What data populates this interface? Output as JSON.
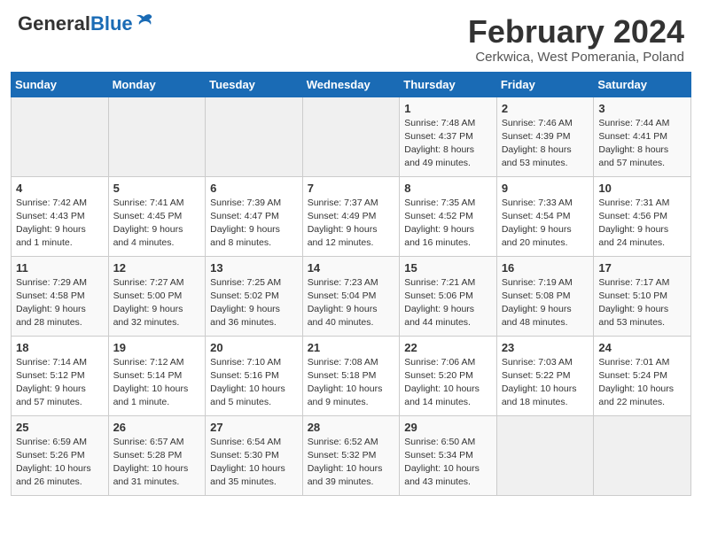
{
  "header": {
    "logo_general": "General",
    "logo_blue": "Blue",
    "month_title": "February 2024",
    "subtitle": "Cerkwica, West Pomerania, Poland"
  },
  "days_of_week": [
    "Sunday",
    "Monday",
    "Tuesday",
    "Wednesday",
    "Thursday",
    "Friday",
    "Saturday"
  ],
  "weeks": [
    [
      {
        "day": "",
        "info": ""
      },
      {
        "day": "",
        "info": ""
      },
      {
        "day": "",
        "info": ""
      },
      {
        "day": "",
        "info": ""
      },
      {
        "day": "1",
        "info": "Sunrise: 7:48 AM\nSunset: 4:37 PM\nDaylight: 8 hours\nand 49 minutes."
      },
      {
        "day": "2",
        "info": "Sunrise: 7:46 AM\nSunset: 4:39 PM\nDaylight: 8 hours\nand 53 minutes."
      },
      {
        "day": "3",
        "info": "Sunrise: 7:44 AM\nSunset: 4:41 PM\nDaylight: 8 hours\nand 57 minutes."
      }
    ],
    [
      {
        "day": "4",
        "info": "Sunrise: 7:42 AM\nSunset: 4:43 PM\nDaylight: 9 hours\nand 1 minute."
      },
      {
        "day": "5",
        "info": "Sunrise: 7:41 AM\nSunset: 4:45 PM\nDaylight: 9 hours\nand 4 minutes."
      },
      {
        "day": "6",
        "info": "Sunrise: 7:39 AM\nSunset: 4:47 PM\nDaylight: 9 hours\nand 8 minutes."
      },
      {
        "day": "7",
        "info": "Sunrise: 7:37 AM\nSunset: 4:49 PM\nDaylight: 9 hours\nand 12 minutes."
      },
      {
        "day": "8",
        "info": "Sunrise: 7:35 AM\nSunset: 4:52 PM\nDaylight: 9 hours\nand 16 minutes."
      },
      {
        "day": "9",
        "info": "Sunrise: 7:33 AM\nSunset: 4:54 PM\nDaylight: 9 hours\nand 20 minutes."
      },
      {
        "day": "10",
        "info": "Sunrise: 7:31 AM\nSunset: 4:56 PM\nDaylight: 9 hours\nand 24 minutes."
      }
    ],
    [
      {
        "day": "11",
        "info": "Sunrise: 7:29 AM\nSunset: 4:58 PM\nDaylight: 9 hours\nand 28 minutes."
      },
      {
        "day": "12",
        "info": "Sunrise: 7:27 AM\nSunset: 5:00 PM\nDaylight: 9 hours\nand 32 minutes."
      },
      {
        "day": "13",
        "info": "Sunrise: 7:25 AM\nSunset: 5:02 PM\nDaylight: 9 hours\nand 36 minutes."
      },
      {
        "day": "14",
        "info": "Sunrise: 7:23 AM\nSunset: 5:04 PM\nDaylight: 9 hours\nand 40 minutes."
      },
      {
        "day": "15",
        "info": "Sunrise: 7:21 AM\nSunset: 5:06 PM\nDaylight: 9 hours\nand 44 minutes."
      },
      {
        "day": "16",
        "info": "Sunrise: 7:19 AM\nSunset: 5:08 PM\nDaylight: 9 hours\nand 48 minutes."
      },
      {
        "day": "17",
        "info": "Sunrise: 7:17 AM\nSunset: 5:10 PM\nDaylight: 9 hours\nand 53 minutes."
      }
    ],
    [
      {
        "day": "18",
        "info": "Sunrise: 7:14 AM\nSunset: 5:12 PM\nDaylight: 9 hours\nand 57 minutes."
      },
      {
        "day": "19",
        "info": "Sunrise: 7:12 AM\nSunset: 5:14 PM\nDaylight: 10 hours\nand 1 minute."
      },
      {
        "day": "20",
        "info": "Sunrise: 7:10 AM\nSunset: 5:16 PM\nDaylight: 10 hours\nand 5 minutes."
      },
      {
        "day": "21",
        "info": "Sunrise: 7:08 AM\nSunset: 5:18 PM\nDaylight: 10 hours\nand 9 minutes."
      },
      {
        "day": "22",
        "info": "Sunrise: 7:06 AM\nSunset: 5:20 PM\nDaylight: 10 hours\nand 14 minutes."
      },
      {
        "day": "23",
        "info": "Sunrise: 7:03 AM\nSunset: 5:22 PM\nDaylight: 10 hours\nand 18 minutes."
      },
      {
        "day": "24",
        "info": "Sunrise: 7:01 AM\nSunset: 5:24 PM\nDaylight: 10 hours\nand 22 minutes."
      }
    ],
    [
      {
        "day": "25",
        "info": "Sunrise: 6:59 AM\nSunset: 5:26 PM\nDaylight: 10 hours\nand 26 minutes."
      },
      {
        "day": "26",
        "info": "Sunrise: 6:57 AM\nSunset: 5:28 PM\nDaylight: 10 hours\nand 31 minutes."
      },
      {
        "day": "27",
        "info": "Sunrise: 6:54 AM\nSunset: 5:30 PM\nDaylight: 10 hours\nand 35 minutes."
      },
      {
        "day": "28",
        "info": "Sunrise: 6:52 AM\nSunset: 5:32 PM\nDaylight: 10 hours\nand 39 minutes."
      },
      {
        "day": "29",
        "info": "Sunrise: 6:50 AM\nSunset: 5:34 PM\nDaylight: 10 hours\nand 43 minutes."
      },
      {
        "day": "",
        "info": ""
      },
      {
        "day": "",
        "info": ""
      }
    ]
  ]
}
